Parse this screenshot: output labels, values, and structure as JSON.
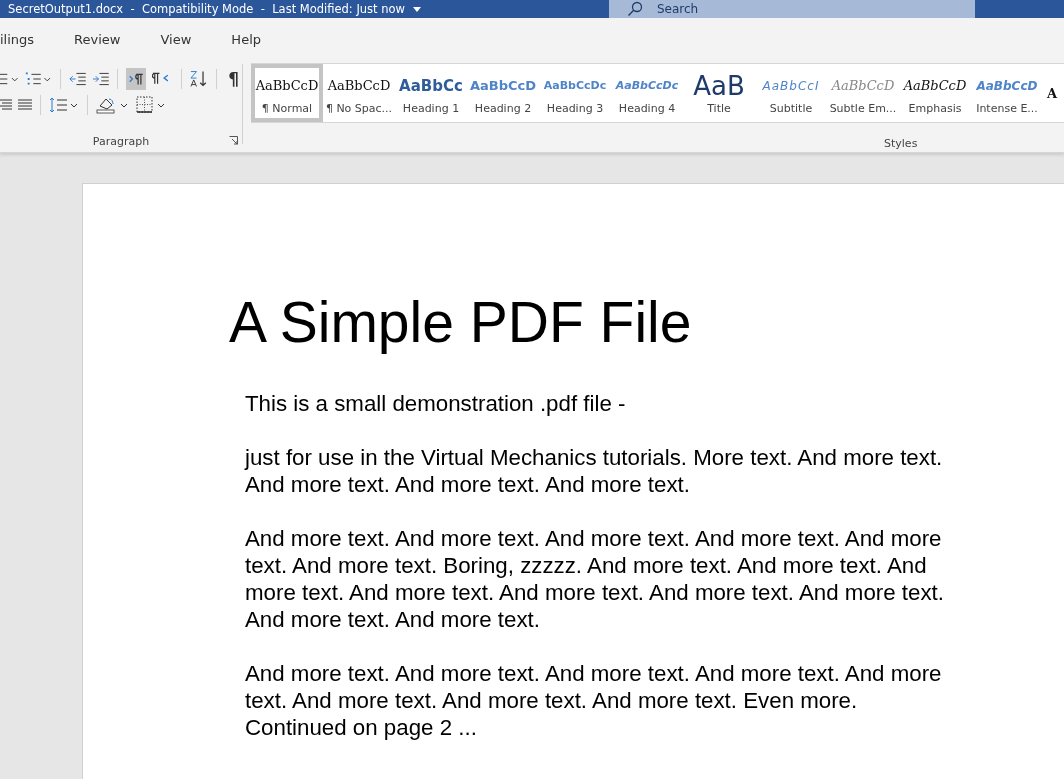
{
  "title_bar": {
    "title": "SecretOutput1.docx  -  Compatibility Mode  -  Last Modified: Just now",
    "search_placeholder": "Search"
  },
  "tabs": [
    {
      "label": "ilings",
      "selected": false
    },
    {
      "label": "Review",
      "selected": false
    },
    {
      "label": "View",
      "selected": false
    },
    {
      "label": "Help",
      "selected": false
    }
  ],
  "paragraph_group": {
    "label": "Paragraph",
    "show_marks": "¶",
    "ltr_selected": true
  },
  "styles": {
    "label": "Styles",
    "items": [
      {
        "preview": "AaBbCcD",
        "label": "¶ Normal",
        "kind": "normal",
        "selected": true
      },
      {
        "preview": "AaBbCcD",
        "label": "¶ No Spac...",
        "kind": "nospacing",
        "selected": false
      },
      {
        "preview": "AaBbCc",
        "label": "Heading 1",
        "kind": "heading1",
        "selected": false
      },
      {
        "preview": "AaBbCcD",
        "label": "Heading 2",
        "kind": "heading2",
        "selected": false
      },
      {
        "preview": "AaBbCcDc",
        "label": "Heading 3",
        "kind": "heading3",
        "selected": false
      },
      {
        "preview": "AaBbCcDc",
        "label": "Heading 4",
        "kind": "heading4",
        "selected": false
      },
      {
        "preview": "AaB",
        "label": "Title",
        "kind": "title",
        "selected": false
      },
      {
        "preview": "AaBbCcI",
        "label": "Subtitle",
        "kind": "subtitle",
        "selected": false
      },
      {
        "preview": "AaBbCcD",
        "label": "Subtle Em...",
        "kind": "subtle",
        "selected": false
      },
      {
        "preview": "AaBbCcD",
        "label": "Emphasis",
        "kind": "emphasis",
        "selected": false
      },
      {
        "preview": "AaBbCcD",
        "label": "Intense E...",
        "kind": "intense",
        "selected": false
      },
      {
        "preview": "A",
        "kind": "strong",
        "selected": false
      }
    ]
  },
  "document": {
    "title": "A Simple PDF File",
    "paragraphs": [
      "This is a small demonstration .pdf file -",
      "just for use in the Virtual Mechanics tutorials. More text. And more text. And more text. And more text. And more text.",
      "And more text. And more text. And more text. And more text. And more text. And more text. Boring, zzzzz. And more text. And more text. And more text. And more text. And more text. And more text. And more text. And more text. And more text.",
      "And more text. And more text. And more text. And more text. And more text. And more text. And more text. And more text. Even more. Continued on page 2 ..."
    ]
  }
}
